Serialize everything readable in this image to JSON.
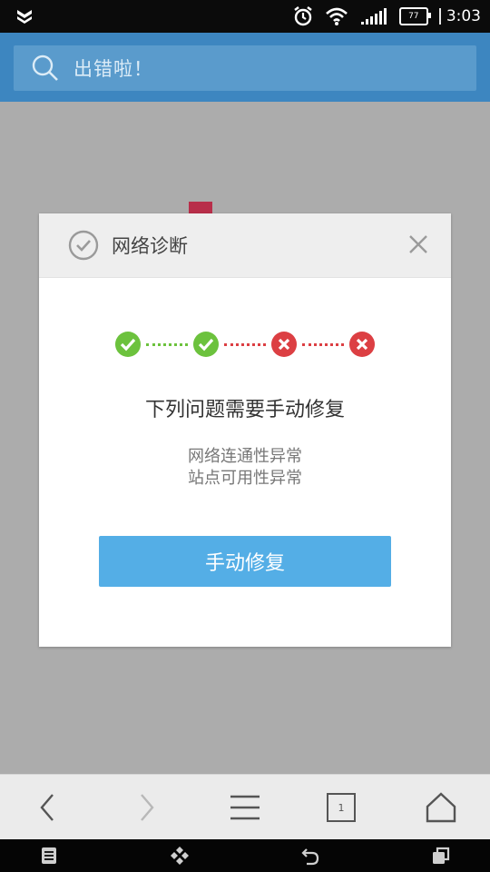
{
  "status_bar": {
    "battery": "77",
    "time": "3:03",
    "icons": [
      "app-icon",
      "alarm-icon",
      "wifi-icon",
      "signal-icon",
      "battery-icon"
    ]
  },
  "search": {
    "text": "出错啦！",
    "icon": "search-icon"
  },
  "dialog": {
    "title": "网络诊断",
    "message": "下列问题需要手动修复",
    "issues": [
      "网络连通性异常",
      "站点可用性异常"
    ],
    "button_label": "手动修复",
    "steps": [
      "ok",
      "ok",
      "error",
      "error"
    ],
    "colors": {
      "ok": "#6cc23d",
      "error": "#dc3f43",
      "button": "#54aee6"
    }
  },
  "browser_toolbar": {
    "items": [
      "back-icon",
      "forward-icon",
      "menu-icon",
      "tabs-icon",
      "home-icon"
    ],
    "tab_count": "1"
  },
  "system_nav": {
    "items": [
      "menu-icon",
      "apps-icon",
      "back-icon",
      "recent-apps-icon"
    ]
  }
}
